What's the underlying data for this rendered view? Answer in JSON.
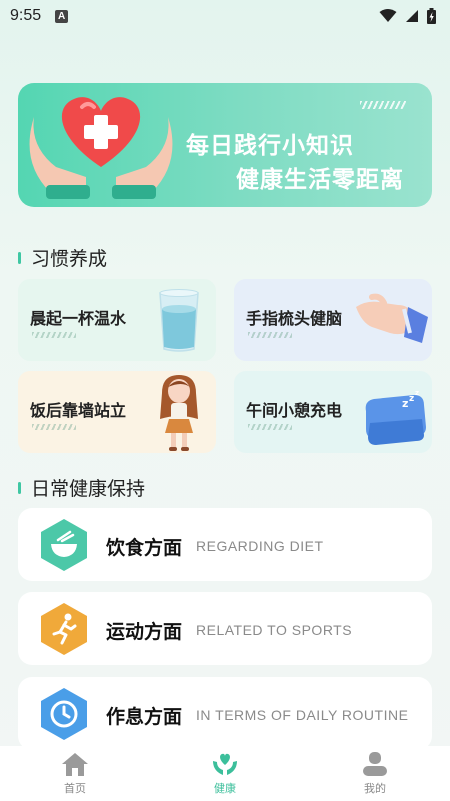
{
  "status": {
    "time": "9:55",
    "notif_glyph": "A"
  },
  "banner": {
    "line1": "每日践行小知识",
    "line2": "健康生活零距离",
    "icon": "heart-hands-icon"
  },
  "habits": {
    "title": "习惯养成",
    "items": [
      {
        "label": "晨起一杯温水",
        "icon": "water-glass-icon",
        "bg": "#e6f6ef"
      },
      {
        "label": "手指梳头健脑",
        "icon": "pointing-hand-icon",
        "bg": "#e6eef9"
      },
      {
        "label": "饭后靠墙站立",
        "icon": "girl-figure-icon",
        "bg": "#fbf3e4"
      },
      {
        "label": "午间小憩充电",
        "icon": "sleep-pillow-icon",
        "bg": "#e4f5f3"
      }
    ]
  },
  "daily": {
    "title": "日常健康保持",
    "items": [
      {
        "title": "饮食方面",
        "subtitle": "REGARDING DIET",
        "icon": "food-bowl-icon",
        "color": "#4cc8a8"
      },
      {
        "title": "运动方面",
        "subtitle": "RELATED TO SPORTS",
        "icon": "running-icon",
        "color": "#f0a93a"
      },
      {
        "title": "作息方面",
        "subtitle": "IN TERMS OF DAILY ROUTINE",
        "icon": "clock-icon",
        "color": "#4a9ee8"
      }
    ]
  },
  "nav": {
    "items": [
      {
        "label": "首页",
        "icon": "home-icon",
        "active": false
      },
      {
        "label": "健康",
        "icon": "health-heart-icon",
        "active": true
      },
      {
        "label": "我的",
        "icon": "user-icon",
        "active": false
      }
    ]
  },
  "colors": {
    "accent": "#3cbf9b",
    "banner": "#6cd9bb"
  }
}
